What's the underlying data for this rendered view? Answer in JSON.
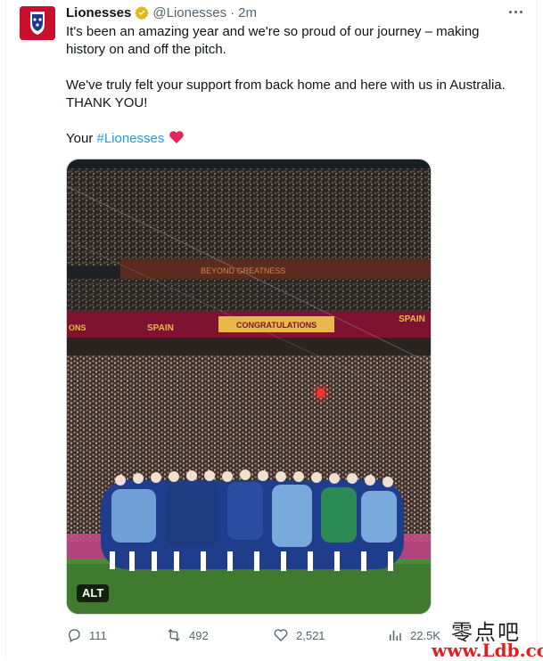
{
  "tweet": {
    "author_name": "Lionesses",
    "handle": "@Lionesses",
    "separator": "·",
    "time": "2m",
    "paragraph1": "It's been an amazing year and we're so proud of our journey – making history on and off the pitch.",
    "paragraph2": "We've truly felt your support from back home and here with us in Australia. THANK YOU!",
    "paragraph3_prefix": "Your ",
    "hashtag": "#Lionesses",
    "alt_badge": "ALT",
    "stadium_banner_1": "BEYOND GREATNESS",
    "stadium_banner_2": "CONGRATULATIONS",
    "banner_spain": "SPAIN",
    "banner_left": "ONS"
  },
  "actions": {
    "replies": "111",
    "retweets": "492",
    "likes": "2,521",
    "views": "22.5K"
  },
  "watermark": {
    "chinese": "零点吧",
    "url": "www.Ldb.cc"
  },
  "colors": {
    "link": "#1d9bf0",
    "heart": "#e0245e",
    "verified": "#e2b719"
  },
  "icons": [
    "more-icon",
    "verified-badge-icon",
    "heart-emoji-icon",
    "reply-icon",
    "retweet-icon",
    "like-icon",
    "views-icon"
  ]
}
